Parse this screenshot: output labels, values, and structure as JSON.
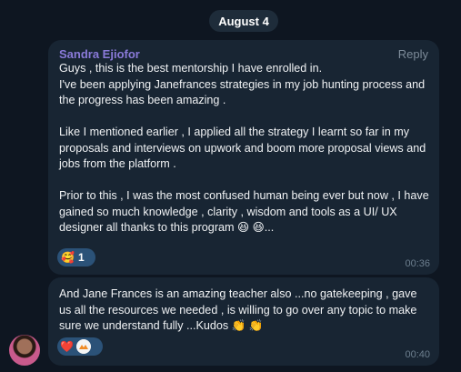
{
  "date_separator": "August 4",
  "messages": [
    {
      "sender": "Sandra Ejiofor",
      "reply_label": "Reply",
      "text": "Guys , this is the best mentorship I have enrolled in.\nI've been applying Janefrances strategies in my job hunting process and the progress has been amazing .\n\nLike I mentioned earlier , I applied all the strategy I learnt so far in my proposals and interviews on upwork and boom more proposal views and jobs from the platform .\n\nPrior to this , I was the most confused human being ever but now , I have gained so much knowledge , clarity , wisdom and tools as a UI/ UX designer all thanks to this program 😆 😆...",
      "reaction": {
        "emoji": "🥰",
        "count": "1"
      },
      "time": "00:36"
    },
    {
      "text": "And Jane Frances is an amazing teacher also ...no gatekeeping , gave us all the resources we needed , is willing to go over any topic to make sure we understand fully ...Kudos 👏 👏",
      "reaction": {
        "emoji": "❤️",
        "reactor_avatar": "user-avatar"
      },
      "time": "00:40"
    }
  ],
  "colors": {
    "background": "#0e1621",
    "bubble": "#182533",
    "sender_name": "#8a7ad9",
    "reaction_pill": "#2b5278"
  }
}
